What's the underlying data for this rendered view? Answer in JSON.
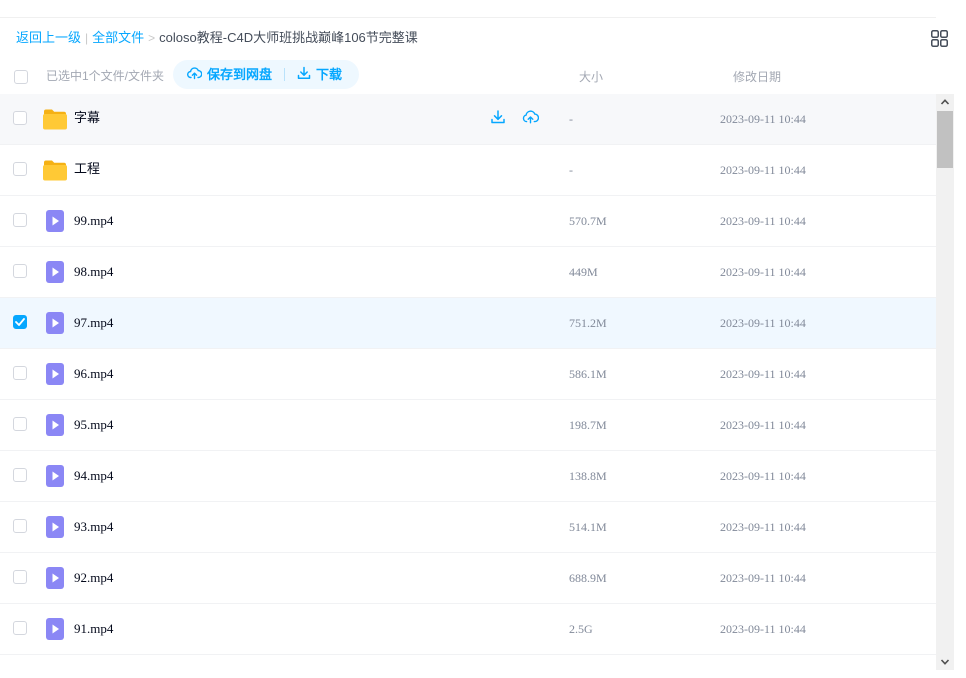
{
  "breadcrumb": {
    "back": "返回上一级",
    "divider": "|",
    "all_files": "全部文件",
    "arrow": ">",
    "current": "coloso教程-C4D大师班挑战巅峰106节完整课"
  },
  "toolbar": {
    "selected_info": "已选中1个文件/文件夹",
    "save_label": "保存到网盘",
    "download_label": "下载"
  },
  "columns": {
    "size": "大小",
    "date": "修改日期"
  },
  "colors": {
    "accent": "#06a7ff",
    "folder": "#ffc935",
    "video": "#8b87f5"
  },
  "files": [
    {
      "name": "字幕",
      "type": "folder",
      "size": "-",
      "date": "2023-09-11 10:44",
      "checked": false,
      "hovered": true
    },
    {
      "name": "工程",
      "type": "folder",
      "size": "-",
      "date": "2023-09-11 10:44",
      "checked": false
    },
    {
      "name": "99.mp4",
      "type": "video",
      "size": "570.7M",
      "date": "2023-09-11 10:44",
      "checked": false
    },
    {
      "name": "98.mp4",
      "type": "video",
      "size": "449M",
      "date": "2023-09-11 10:44",
      "checked": false
    },
    {
      "name": "97.mp4",
      "type": "video",
      "size": "751.2M",
      "date": "2023-09-11 10:44",
      "checked": true
    },
    {
      "name": "96.mp4",
      "type": "video",
      "size": "586.1M",
      "date": "2023-09-11 10:44",
      "checked": false
    },
    {
      "name": "95.mp4",
      "type": "video",
      "size": "198.7M",
      "date": "2023-09-11 10:44",
      "checked": false
    },
    {
      "name": "94.mp4",
      "type": "video",
      "size": "138.8M",
      "date": "2023-09-11 10:44",
      "checked": false
    },
    {
      "name": "93.mp4",
      "type": "video",
      "size": "514.1M",
      "date": "2023-09-11 10:44",
      "checked": false
    },
    {
      "name": "92.mp4",
      "type": "video",
      "size": "688.9M",
      "date": "2023-09-11 10:44",
      "checked": false
    },
    {
      "name": "91.mp4",
      "type": "video",
      "size": "2.5G",
      "date": "2023-09-11 10:44",
      "checked": false
    }
  ]
}
